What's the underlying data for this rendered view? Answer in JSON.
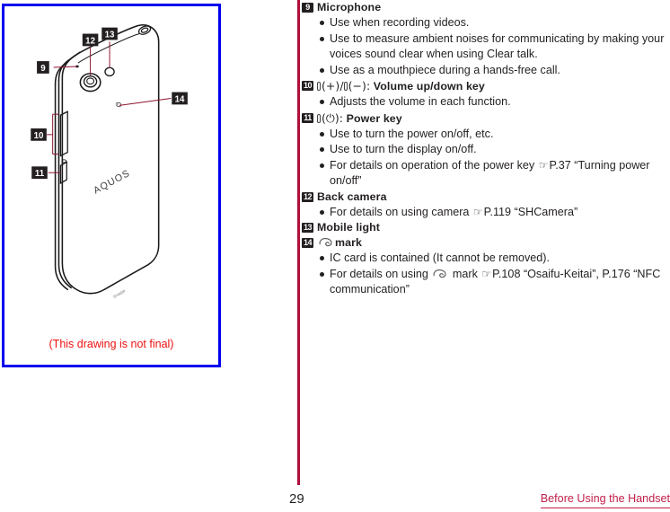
{
  "illustration": {
    "caption": "(This drawing is not final)",
    "brand_text": "AQUOS",
    "border_color": "#0000ee",
    "caption_color": "#ee1111",
    "callouts": [
      {
        "label": "9",
        "target": "microphone"
      },
      {
        "label": "10",
        "target": "volume-up-down-key"
      },
      {
        "label": "11",
        "target": "power-key"
      },
      {
        "label": "12",
        "target": "back-camera"
      },
      {
        "label": "13",
        "target": "mobile-light"
      },
      {
        "label": "14",
        "target": "felica-mark"
      }
    ]
  },
  "content": {
    "rule_color": "#b10f3c",
    "entries": [
      {
        "marker": "9",
        "title": "Microphone",
        "bullets": [
          "Use when recording videos.",
          "Use to measure ambient noises for communicating by making your voices sound clear when using Clear talk.",
          "Use as a mouthpiece during a hands-free call."
        ]
      },
      {
        "marker": "10",
        "title_prefix_symbols": "(+)/(−):",
        "title": "Volume up/down key",
        "bullets": [
          "Adjusts the volume in each function."
        ]
      },
      {
        "marker": "11",
        "title_prefix_symbols": "(⏻):",
        "title": "Power key",
        "bullets": [
          "Use to turn the power on/off, etc.",
          "Use to turn the display on/off.",
          "For details on operation of the power key ☞P.37 “Turning power on/off”"
        ]
      },
      {
        "marker": "12",
        "title": "Back camera",
        "bullets": [
          "For details on using camera ☞P.119 “SHCamera”"
        ]
      },
      {
        "marker": "13",
        "title": "Mobile light",
        "bullets": []
      },
      {
        "marker": "14",
        "title": "mark",
        "title_has_felica_glyph": true,
        "bullets": [
          "IC card is contained (It cannot be removed).",
          "For details on using [felica] mark ☞P.108 “Osaifu-Keitai”, P.176 “NFC communication”"
        ]
      }
    ],
    "references": {
      "power": {
        "icon": "hand-pointer-icon",
        "page": "P.37",
        "title": "“Turning power on/off”"
      },
      "camera": {
        "icon": "hand-pointer-icon",
        "page": "P.119",
        "title": "“SHCamera”"
      },
      "osaifu": {
        "icon": "hand-pointer-icon",
        "page": "P.108",
        "title": "“Osaifu-Keitai”"
      },
      "nfc": {
        "page": "P.176",
        "title": "“NFC communication”"
      }
    }
  },
  "footer": {
    "page_number": "29",
    "section": "Before Using the Handset",
    "section_color": "#c2204a"
  },
  "text_fragments": {
    "e9_b1": "Use when recording videos.",
    "e9_b2": "Use to measure ambient noises for communicating by making your voices sound clear when using Clear talk.",
    "e9_b3": "Use as a mouthpiece during a hands-free call.",
    "e10_b1": "Adjusts the volume in each function.",
    "e11_b1": "Use to turn the power on/off, etc.",
    "e11_b2": "Use to turn the display on/off.",
    "e11_b3_pre": "For details on operation of the power key ",
    "e11_b3_page": "P.37 “Turning power on/off”",
    "e12_b1_pre": "For details on using camera ",
    "e12_b1_page": "P.119 “SHCamera”",
    "e14_b1": "IC card is contained (It cannot be removed).",
    "e14_b2_pre": "For details on using ",
    "e14_b2_mid": " mark ",
    "e14_b2_page": "P.108 “Osaifu-Keitai”, P.176 “NFC communication”",
    "plus_minus": "(+)/",
    "minus_part": "(−):",
    "power_sym": "(⏻):",
    "hand_icon": "☞"
  }
}
